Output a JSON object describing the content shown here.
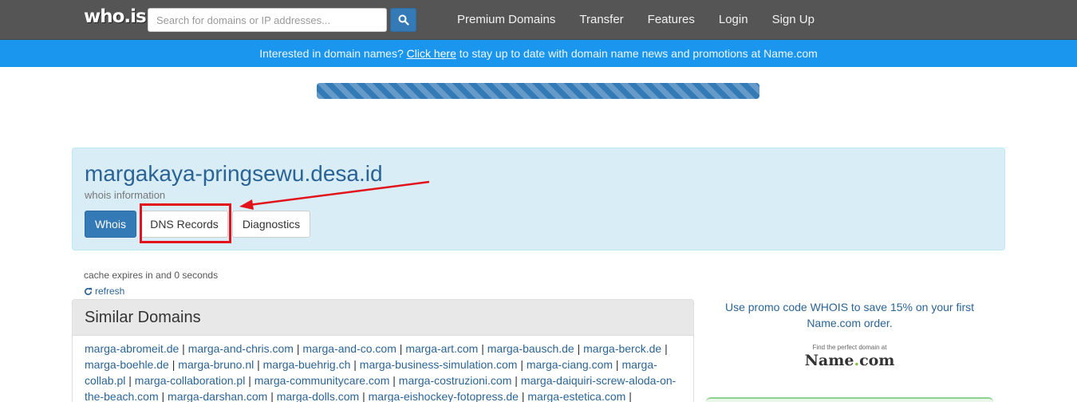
{
  "navbar": {
    "logo": "who.is",
    "search_placeholder": "Search for domains or IP addresses...",
    "links": [
      "Premium Domains",
      "Transfer",
      "Features",
      "Login",
      "Sign Up"
    ]
  },
  "promo_bar": {
    "before": "Interested in domain names? ",
    "link": "Click here",
    "after": " to stay up to date with domain name news and promotions at Name.com"
  },
  "progress": {
    "value_pct": 100
  },
  "domain": {
    "name": "margakaya-pringsewu.desa.id",
    "subtitle": "whois information",
    "tabs": [
      "Whois",
      "DNS Records",
      "Diagnostics"
    ],
    "active_tab": "Whois"
  },
  "cache": {
    "text": "cache expires in and 0 seconds",
    "refresh_label": "refresh"
  },
  "similar": {
    "title": "Similar Domains",
    "domains": [
      "marga-abromeit.de",
      "marga-and-chris.com",
      "marga-and-co.com",
      "marga-art.com",
      "marga-bausch.de",
      "marga-berck.de",
      "marga-boehle.de",
      "marga-bruno.nl",
      "marga-buehrig.ch",
      "marga-business-simulation.com",
      "marga-ciang.com",
      "marga-collab.pl",
      "marga-collaboration.pl",
      "marga-communitycare.com",
      "marga-costruzioni.com",
      "marga-daiquiri-screw-aloda-on-the-beach.com",
      "marga-darshan.com",
      "marga-dolls.com",
      "marga-eishockey-fotopress.de",
      "marga-estetica.com"
    ]
  },
  "sidebar": {
    "promo_text": "Use promo code WHOIS to save 15% on your first Name.com order.",
    "ad_tagline": "Find the perfect domain at",
    "ad_logo_main": "Name",
    "ad_logo_dot": ".",
    "ad_logo_tld": "com"
  },
  "colors": {
    "navbar": "#555555",
    "promo_bar": "#1a96ee",
    "primary": "#337ab7",
    "panel_bg": "#d9edf7",
    "highlight": "#e2131b"
  }
}
